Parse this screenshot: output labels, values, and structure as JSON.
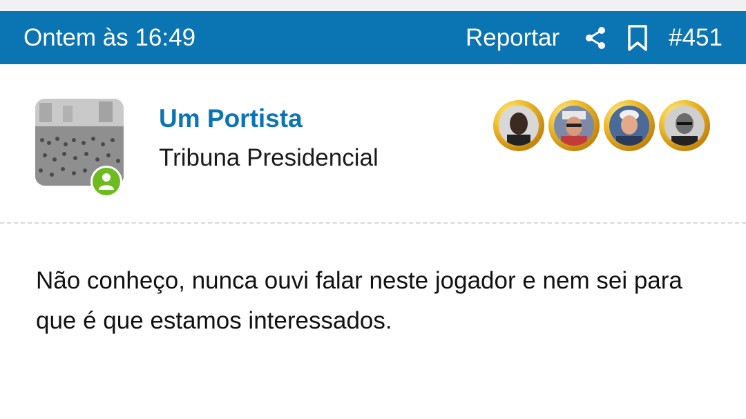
{
  "post": {
    "date": "Ontem às 16:49",
    "report_label": "Reportar",
    "post_number": "#451",
    "icons": [
      "share-icon",
      "bookmark-icon"
    ]
  },
  "author": {
    "name": "Um Portista",
    "title": "Tribuna Presidencial",
    "status": "online",
    "colors": {
      "name": "#0b74b3",
      "online": "#6dbb1f",
      "header": "#0b74b3"
    }
  },
  "medals": [
    "medal-1",
    "medal-2",
    "medal-3",
    "medal-4"
  ],
  "content": {
    "text": "Não conheço, nunca ouvi falar neste jogador e nem sei para que é que estamos interessados."
  }
}
